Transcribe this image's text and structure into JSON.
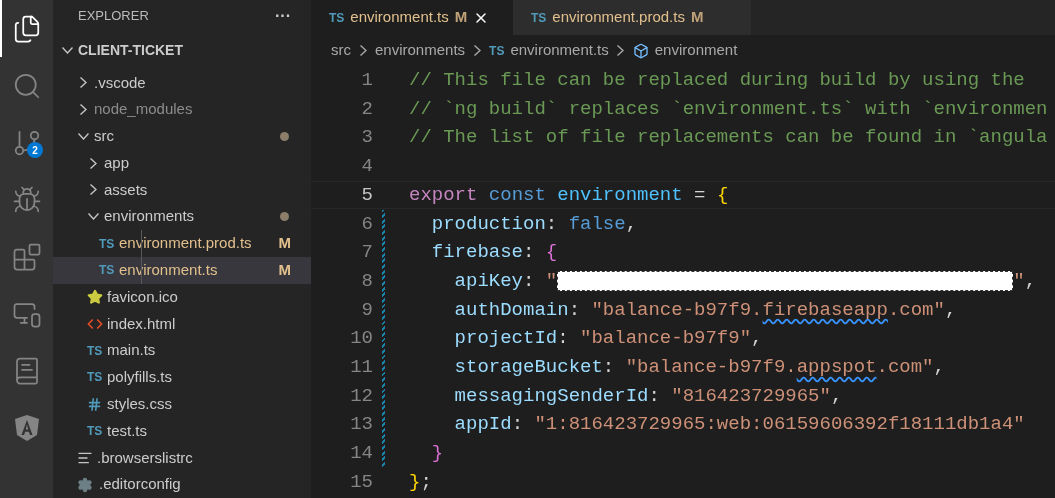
{
  "activity_bar": {
    "items": [
      {
        "kind": "files",
        "selected": true
      },
      {
        "kind": "search",
        "selected": false
      },
      {
        "kind": "source-control",
        "selected": false,
        "badge": "2"
      },
      {
        "kind": "debug",
        "selected": false
      },
      {
        "kind": "extensions",
        "selected": false
      },
      {
        "kind": "remote",
        "selected": false
      },
      {
        "kind": "notebook",
        "selected": false
      },
      {
        "kind": "angular",
        "selected": false
      }
    ]
  },
  "explorer": {
    "title": "EXPLORER",
    "more": "···",
    "project": {
      "name": "CLIENT-TICKET",
      "expanded": true
    },
    "items": [
      {
        "name": ".vscode",
        "kind": "folder",
        "expanded": false,
        "ignored": false,
        "modified": false
      },
      {
        "name": "node_modules",
        "kind": "folder",
        "expanded": false,
        "ignored": true,
        "modified": false
      },
      {
        "name": "src",
        "kind": "folder",
        "expanded": true,
        "ignored": false,
        "modified": true,
        "children": [
          {
            "name": "app",
            "kind": "folder",
            "expanded": false,
            "ignored": false,
            "modified": false
          },
          {
            "name": "assets",
            "kind": "folder",
            "expanded": false,
            "ignored": false,
            "modified": false
          },
          {
            "name": "environments",
            "kind": "folder",
            "expanded": true,
            "ignored": false,
            "modified": true,
            "children": [
              {
                "name": "environment.prod.ts",
                "kind": "ts",
                "tag": "TS",
                "badge": "M",
                "selected": false
              },
              {
                "name": "environment.ts",
                "kind": "ts",
                "tag": "TS",
                "badge": "M",
                "selected": true
              }
            ]
          },
          {
            "name": "favicon.ico",
            "kind": "star",
            "selected": false
          },
          {
            "name": "index.html",
            "kind": "html",
            "selected": false
          },
          {
            "name": "main.ts",
            "kind": "ts",
            "tag": "TS",
            "selected": false
          },
          {
            "name": "polyfills.ts",
            "kind": "ts",
            "tag": "TS",
            "selected": false
          },
          {
            "name": "styles.css",
            "kind": "css",
            "selected": false
          },
          {
            "name": "test.ts",
            "kind": "ts",
            "tag": "TS",
            "selected": false
          }
        ]
      },
      {
        "name": ".browserslistrc",
        "kind": "lines",
        "selected": false
      },
      {
        "name": ".editorconfig",
        "kind": "gear",
        "selected": false
      }
    ]
  },
  "tabs": [
    {
      "label": "environment.ts",
      "tag": "TS",
      "badge": "M",
      "selected": true
    },
    {
      "label": "environment.prod.ts",
      "tag": "TS",
      "badge": "M",
      "selected": false
    }
  ],
  "breadcrumbs": [
    {
      "label": "src",
      "kind": "folder"
    },
    {
      "label": "environments",
      "kind": "folder"
    },
    {
      "label": "environment.ts",
      "kind": "ts",
      "tag": "TS"
    },
    {
      "label": "environment",
      "kind": "symbol"
    }
  ],
  "editor": {
    "lines": [
      {
        "number": "1",
        "current": false,
        "tokens": [
          {
            "kind": "comment",
            "s": "// This file can be replaced during build by using the"
          }
        ]
      },
      {
        "number": "2",
        "current": false,
        "tokens": [
          {
            "kind": "comment",
            "s": "// `ng build` replaces `environment.ts` with `environmen"
          }
        ]
      },
      {
        "number": "3",
        "current": false,
        "tokens": [
          {
            "kind": "comment",
            "s": "// The list of file replacements can be found in `angula"
          }
        ]
      },
      {
        "number": "4",
        "current": false
      },
      {
        "number": "5",
        "current": true,
        "tokens": [
          {
            "kind": "keyword",
            "s": "export"
          },
          {
            "kind": "storage",
            "s": " const"
          },
          {
            "kind": "constant",
            "s": " environment"
          },
          {
            "kind": "plain",
            "s": " = "
          },
          {
            "kind": "bracket1",
            "s": "{"
          }
        ]
      },
      {
        "number": "6",
        "current": false,
        "tokens": [
          {
            "kind": "prop",
            "s": "  production"
          },
          {
            "kind": "plain",
            "s": ": "
          },
          {
            "kind": "storage",
            "s": "false"
          },
          {
            "kind": "plain",
            "s": ","
          }
        ]
      },
      {
        "number": "7",
        "current": false,
        "tokens": [
          {
            "kind": "prop",
            "s": "  firebase"
          },
          {
            "kind": "plain",
            "s": ": "
          },
          {
            "kind": "bracket2",
            "s": "{"
          }
        ]
      },
      {
        "number": "8",
        "current": false,
        "tokens": [
          {
            "kind": "prop",
            "s": "    apiKey"
          },
          {
            "kind": "plain",
            "s": ": "
          },
          {
            "kind": "string",
            "s": "\""
          },
          {
            "kind": "redacted"
          },
          {
            "kind": "string",
            "s": "\""
          },
          {
            "kind": "plain",
            "s": ","
          }
        ]
      },
      {
        "number": "9",
        "current": false,
        "tokens": [
          {
            "kind": "prop",
            "s": "    authDomain"
          },
          {
            "kind": "plain",
            "s": ": "
          },
          {
            "kind": "string",
            "s": "\"balance-b97f9."
          },
          {
            "kind": "squiggle",
            "s": "firebaseapp"
          },
          {
            "kind": "string",
            "s": ".com\""
          },
          {
            "kind": "plain",
            "s": ","
          }
        ]
      },
      {
        "number": "10",
        "current": false,
        "tokens": [
          {
            "kind": "prop",
            "s": "    projectId"
          },
          {
            "kind": "plain",
            "s": ": "
          },
          {
            "kind": "string",
            "s": "\"balance-b97f9\""
          },
          {
            "kind": "plain",
            "s": ","
          }
        ]
      },
      {
        "number": "11",
        "current": false,
        "tokens": [
          {
            "kind": "prop",
            "s": "    storageBucket"
          },
          {
            "kind": "plain",
            "s": ": "
          },
          {
            "kind": "string",
            "s": "\"balance-b97f9."
          },
          {
            "kind": "squiggle",
            "s": "appspot"
          },
          {
            "kind": "string",
            "s": ".com\""
          },
          {
            "kind": "plain",
            "s": ","
          }
        ]
      },
      {
        "number": "12",
        "current": false,
        "tokens": [
          {
            "kind": "prop",
            "s": "    messagingSenderId"
          },
          {
            "kind": "plain",
            "s": ": "
          },
          {
            "kind": "string",
            "s": "\"816423729965\""
          },
          {
            "kind": "plain",
            "s": ","
          }
        ]
      },
      {
        "number": "13",
        "current": false,
        "tokens": [
          {
            "kind": "prop",
            "s": "    appId"
          },
          {
            "kind": "plain",
            "s": ": "
          },
          {
            "kind": "string",
            "s": "\"1:816423729965:web:06159606392f18111db1a4\""
          }
        ]
      },
      {
        "number": "14",
        "current": false,
        "tokens": [
          {
            "kind": "bracket2",
            "s": "  }"
          }
        ]
      },
      {
        "number": "15",
        "current": false,
        "tokens": [
          {
            "kind": "bracket1",
            "s": "}"
          },
          {
            "kind": "plain",
            "s": ";"
          }
        ]
      }
    ]
  }
}
